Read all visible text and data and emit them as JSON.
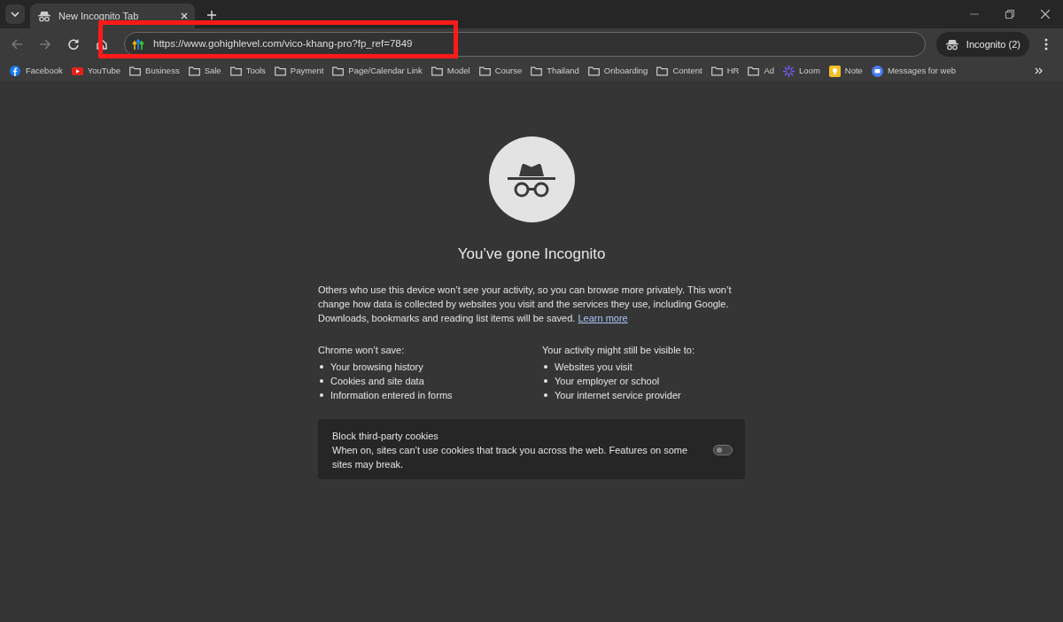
{
  "tab": {
    "title": "New Incognito Tab",
    "selected": true
  },
  "address_bar": {
    "url": "https://www.gohighlevel.com/vico-khang-pro?fp_ref=7849",
    "highlighted": true
  },
  "profile_button": {
    "label": "Incognito (2)"
  },
  "bookmarks": [
    {
      "kind": "facebook",
      "label": "Facebook"
    },
    {
      "kind": "youtube",
      "label": "YouTube"
    },
    {
      "kind": "folder",
      "label": "Business"
    },
    {
      "kind": "folder",
      "label": "Sale"
    },
    {
      "kind": "folder",
      "label": "Tools"
    },
    {
      "kind": "folder",
      "label": "Payment"
    },
    {
      "kind": "folder",
      "label": "Page/Calendar Link"
    },
    {
      "kind": "folder",
      "label": "Model"
    },
    {
      "kind": "folder",
      "label": "Course"
    },
    {
      "kind": "folder",
      "label": "Thailand"
    },
    {
      "kind": "folder",
      "label": "Onboarding"
    },
    {
      "kind": "folder",
      "label": "Content"
    },
    {
      "kind": "folder",
      "label": "HR"
    },
    {
      "kind": "folder",
      "label": "Ad"
    },
    {
      "kind": "loom",
      "label": "Loom"
    },
    {
      "kind": "note",
      "label": "Note"
    },
    {
      "kind": "messages",
      "label": "Messages for web"
    }
  ],
  "page": {
    "heading": "You’ve gone Incognito",
    "intro": "Others who use this device won’t see your activity, so you can browse more privately. This won’t change how data is collected by websites you visit and the services they use, including Google. Downloads, bookmarks and reading list items will be saved.",
    "learn_more": "Learn more",
    "columns": [
      {
        "title": "Chrome won’t save:",
        "items": [
          "Your browsing history",
          "Cookies and site data",
          "Information entered in forms"
        ]
      },
      {
        "title": "Your activity might still be visible to:",
        "items": [
          "Websites you visit",
          "Your employer or school",
          "Your internet service provider"
        ]
      }
    ],
    "cookie_card": {
      "title": "Block third-party cookies",
      "description": "When on, sites can’t use cookies that track you across the web. Features on some sites may break.",
      "on": false
    }
  }
}
